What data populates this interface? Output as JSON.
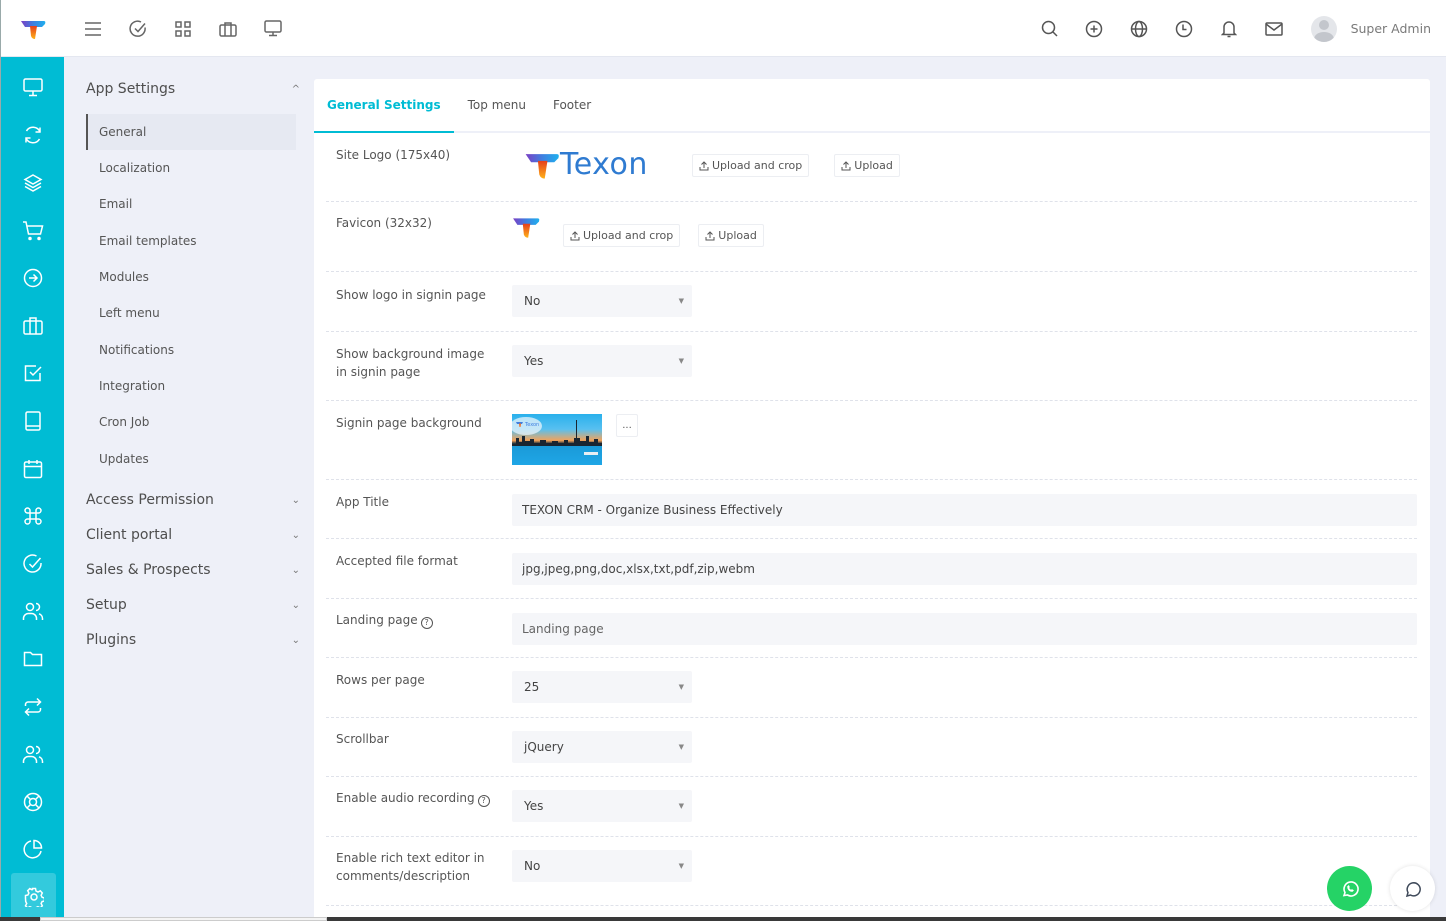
{
  "topbar": {
    "brand_icon": "texon-logo-icon",
    "left_icons": [
      "menu-icon",
      "check-circle-icon",
      "grid-icon",
      "briefcase-icon",
      "monitor-icon"
    ],
    "right_icons": [
      "search-icon",
      "plus-circle-icon",
      "globe-icon",
      "clock-icon",
      "bell-icon",
      "mail-icon"
    ],
    "user_name": "Super Admin"
  },
  "rail": {
    "icons": [
      "monitor-icon",
      "refresh-icon",
      "layers-icon",
      "cart-icon",
      "arrow-circle-right-icon",
      "briefcase-icon",
      "check-square-icon",
      "book-icon",
      "calendar-icon",
      "command-icon",
      "check-circle-icon",
      "users-icon",
      "folder-icon",
      "repeat-icon",
      "users-icon",
      "life-buoy-icon",
      "pie-chart-icon",
      "settings-icon"
    ],
    "active_index": 17
  },
  "sidenav": {
    "app_settings": {
      "label": "App Settings",
      "expanded": true,
      "items": [
        "General",
        "Localization",
        "Email",
        "Email templates",
        "Modules",
        "Left menu",
        "Notifications",
        "Integration",
        "Cron Job",
        "Updates"
      ],
      "active": "General"
    },
    "groups": [
      "Access Permission",
      "Client portal",
      "Sales & Prospects",
      "Setup",
      "Plugins"
    ]
  },
  "tabs": [
    {
      "label": "General Settings",
      "active": true
    },
    {
      "label": "Top menu",
      "active": false
    },
    {
      "label": "Footer",
      "active": false
    }
  ],
  "form": {
    "site_logo": {
      "label": "Site Logo (175x40)",
      "logo_text": "Texon",
      "upload_crop": "Upload and crop",
      "upload": "Upload"
    },
    "favicon": {
      "label": "Favicon (32x32)",
      "upload_crop": "Upload and crop",
      "upload": "Upload"
    },
    "show_logo_signin": {
      "label": "Show logo in signin page",
      "value": "No"
    },
    "show_bg_signin": {
      "label": "Show background image in signin page",
      "value": "Yes"
    },
    "signin_bg": {
      "label": "Signin page background",
      "button": "..."
    },
    "app_title": {
      "label": "App Title",
      "value": "TEXON CRM - Organize Business Effectively"
    },
    "accepted_format": {
      "label": "Accepted file format",
      "value": "jpg,jpeg,png,doc,xlsx,txt,pdf,zip,webm"
    },
    "landing_page": {
      "label": "Landing page",
      "value": "",
      "placeholder": "Landing page"
    },
    "rows_per_page": {
      "label": "Rows per page",
      "value": "25"
    },
    "scrollbar": {
      "label": "Scrollbar",
      "value": "jQuery"
    },
    "audio_recording": {
      "label": "Enable audio recording",
      "value": "Yes"
    },
    "rich_text": {
      "label": "Enable rich text editor in comments/description",
      "value": "No"
    }
  },
  "help_glyph": "?",
  "caret_glyph": "▼",
  "colors": {
    "accent": "#00bcd4",
    "whatsapp": "#25d366"
  }
}
